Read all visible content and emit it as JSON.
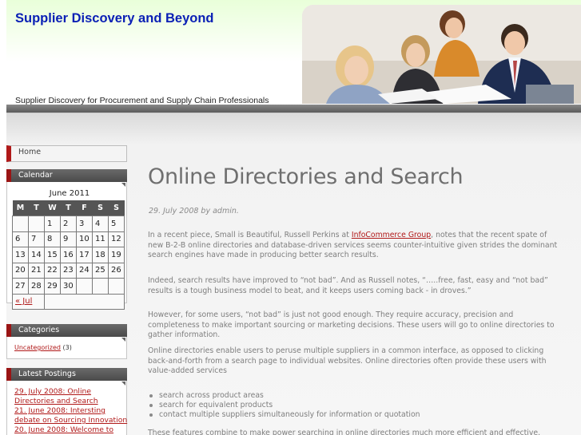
{
  "header": {
    "title": "Supplier Discovery and Beyond",
    "tagline": "Supplier Discovery for Procurement and Supply Chain Professionals"
  },
  "sidebar": {
    "home_label": "Home",
    "calendar": {
      "heading": "Calendar",
      "month": "June 2011",
      "weekdays": [
        "M",
        "T",
        "W",
        "T",
        "F",
        "S",
        "S"
      ],
      "weeks": [
        [
          "",
          "",
          "1",
          "2",
          "3",
          "4",
          "5"
        ],
        [
          "6",
          "7",
          "8",
          "9",
          "10",
          "11",
          "12"
        ],
        [
          "13",
          "14",
          "15",
          "16",
          "17",
          "18",
          "19"
        ],
        [
          "20",
          "21",
          "22",
          "23",
          "24",
          "25",
          "26"
        ],
        [
          "27",
          "28",
          "29",
          "30",
          "",
          "",
          ""
        ]
      ],
      "prev_link": "« Jul"
    },
    "categories": {
      "heading": "Categories",
      "items": [
        {
          "label": "Uncategorized",
          "count": "(3)"
        }
      ]
    },
    "latest": {
      "heading": "Latest Postings",
      "items": [
        "29. July 2008: Online Directories and Search",
        "21. June 2008: Intersting debate on Sourcing Innovation",
        "20. June 2008: Welcome to"
      ]
    }
  },
  "post": {
    "title": "Online Directories and Search",
    "meta": "29. July 2008 by admin.",
    "p1_before": "In a recent piece, Small is Beautiful, Russell Perkins at ",
    "p1_link": "InfoCommerce Group",
    "p1_after": ", notes that the recent spate of new B-2-B online directories and database-driven services seems counter-intuitive given strides the dominant search engines have made in producing better search results.",
    "p2": " Indeed, search results have improved to “not bad”.  And as Russell notes, “…..free, fast, easy and “not bad” results is a tough business model to beat, and it keeps users coming back - in droves.”",
    "p3": "However, for some users, “not bad” is just not good enough.  They require accuracy, precision and completeness to make important sourcing or marketing decisions. These users will go to online directories to gather information.",
    "p4": "Online directories enable users to peruse multiple suppliers in a common interface, as opposed to clicking back-and-forth from a search page to individual websites.  Online directories often provide these users with value-added services",
    "bullets": [
      "search across product areas",
      "search for equivalent products",
      "contact multiple suppliers simultaneously for information or quotation"
    ],
    "p5": "These features combine to make power searching in online directories much more efficient and effective."
  },
  "colors": {
    "title_blue": "#0a1fb5",
    "accent_red": "#b01818",
    "sidebar_head": "#555555"
  }
}
